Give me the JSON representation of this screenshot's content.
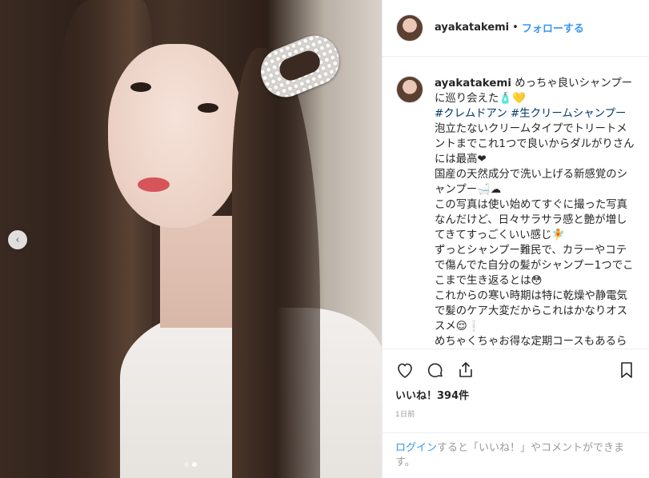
{
  "header": {
    "username": "ayakatakemi",
    "separator": "•",
    "follow_label": "フォローする"
  },
  "caption": {
    "username": "ayakatakemi",
    "line1": "めっちゃ良いシャンプーに巡り会えた🧴💛",
    "hashtag1": "#クレムドアン",
    "hashtag2": "#生クリームシャンプー",
    "p1": "泡立たないクリームタイプでトリートメントまでこれ1つで良いからダルがりさんには最高❤",
    "p2": "国産の天然成分で洗い上げる新感覚のシャンプー🛁☁",
    "p3": "この写真は使い始めてすぐに撮った写真なんだけど、日々サラサラ感と艶が増してきてすっごくいい感じ🧚",
    "p4": "ずっとシャンプー難民で、カラーやコテで傷んでた自分の髪がシャンプー1つでここまで生き返るとは😳",
    "p5": "これからの寒い時期は特に乾燥や静電気で髪のケア大変だからこれはかなりオススメ😌❕",
    "p6": "めちゃくちゃお得な定期コースもあるらしい"
  },
  "actions": {
    "like_icon": "heart-icon",
    "comment_icon": "comment-icon",
    "share_icon": "share-icon",
    "save_icon": "bookmark-icon"
  },
  "likes": {
    "label": "いいね！394件"
  },
  "timestamp": "1日前",
  "login": {
    "link": "ログイン",
    "rest": "すると「いいね！」やコメントができます。"
  },
  "carousel": {
    "prev_icon": "chevron-left-icon",
    "total": 2,
    "active": 2
  },
  "colors": {
    "link": "#3897f0",
    "hashtag": "#003569",
    "text": "#262626",
    "muted": "#999999"
  }
}
